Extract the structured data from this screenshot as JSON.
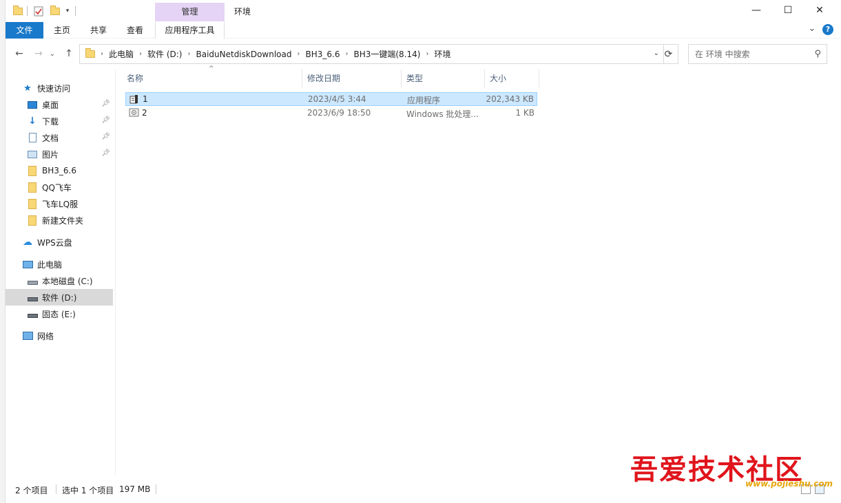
{
  "titlebar": {
    "manage_tab": "管理",
    "title": "环境",
    "minimize": "—",
    "maximize": "☐",
    "close": "✕"
  },
  "ribbon": {
    "tabs": [
      {
        "label": "文件"
      },
      {
        "label": "主页"
      },
      {
        "label": "共享"
      },
      {
        "label": "查看"
      },
      {
        "label": "应用程序工具"
      }
    ],
    "expand": "⌄",
    "help": "?"
  },
  "nav": {
    "back": "←",
    "forward": "→",
    "recent": "⌄",
    "up": "↑",
    "breadcrumb": [
      "此电脑",
      "软件 (D:)",
      "BaiduNetdiskDownload",
      "BH3_6.6",
      "BH3一键端(8.14)",
      "环境"
    ],
    "refresh": "⟳",
    "search_placeholder": "在 环境 中搜索"
  },
  "sidebar": {
    "items": [
      {
        "label": "快速访问",
        "icon": "star-icon",
        "pinned": false
      },
      {
        "label": "桌面",
        "icon": "desktop-icon",
        "pinned": true
      },
      {
        "label": "下载",
        "icon": "download-icon",
        "pinned": true
      },
      {
        "label": "文档",
        "icon": "document-icon",
        "pinned": true
      },
      {
        "label": "图片",
        "icon": "picture-icon",
        "pinned": true
      },
      {
        "label": "BH3_6.6",
        "icon": "folder-icon",
        "pinned": false
      },
      {
        "label": "QQ飞车",
        "icon": "folder-icon",
        "pinned": false
      },
      {
        "label": "飞车LQ服",
        "icon": "folder-icon",
        "pinned": false
      },
      {
        "label": "新建文件夹",
        "icon": "folder-icon",
        "pinned": false
      },
      {
        "label": "WPS云盘",
        "icon": "cloud-icon",
        "pinned": false
      },
      {
        "label": "此电脑",
        "icon": "computer-icon",
        "pinned": false
      },
      {
        "label": "本地磁盘 (C:)",
        "icon": "drive-icon",
        "pinned": false
      },
      {
        "label": "软件 (D:)",
        "icon": "drive-icon",
        "pinned": false,
        "selected": true
      },
      {
        "label": "固态 (E:)",
        "icon": "drive-icon",
        "pinned": false
      },
      {
        "label": "网络",
        "icon": "network-icon",
        "pinned": false
      }
    ]
  },
  "filelist": {
    "columns": [
      "名称",
      "修改日期",
      "类型",
      "大小"
    ],
    "rows": [
      {
        "name": "1",
        "date": "2023/4/5 3:44",
        "type": "应用程序",
        "size": "202,343 KB",
        "selected": true,
        "icon": "executable-icon"
      },
      {
        "name": "2",
        "date": "2023/6/9 18:50",
        "type": "Windows 批处理...",
        "size": "1 KB",
        "selected": false,
        "icon": "batch-file-icon"
      }
    ]
  },
  "status": {
    "count": "2 个项目",
    "selection": "选中 1 个项目",
    "size": "197 MB"
  },
  "watermark": {
    "text": "吾爱技术社区",
    "url": "www.pojieshu.com"
  }
}
